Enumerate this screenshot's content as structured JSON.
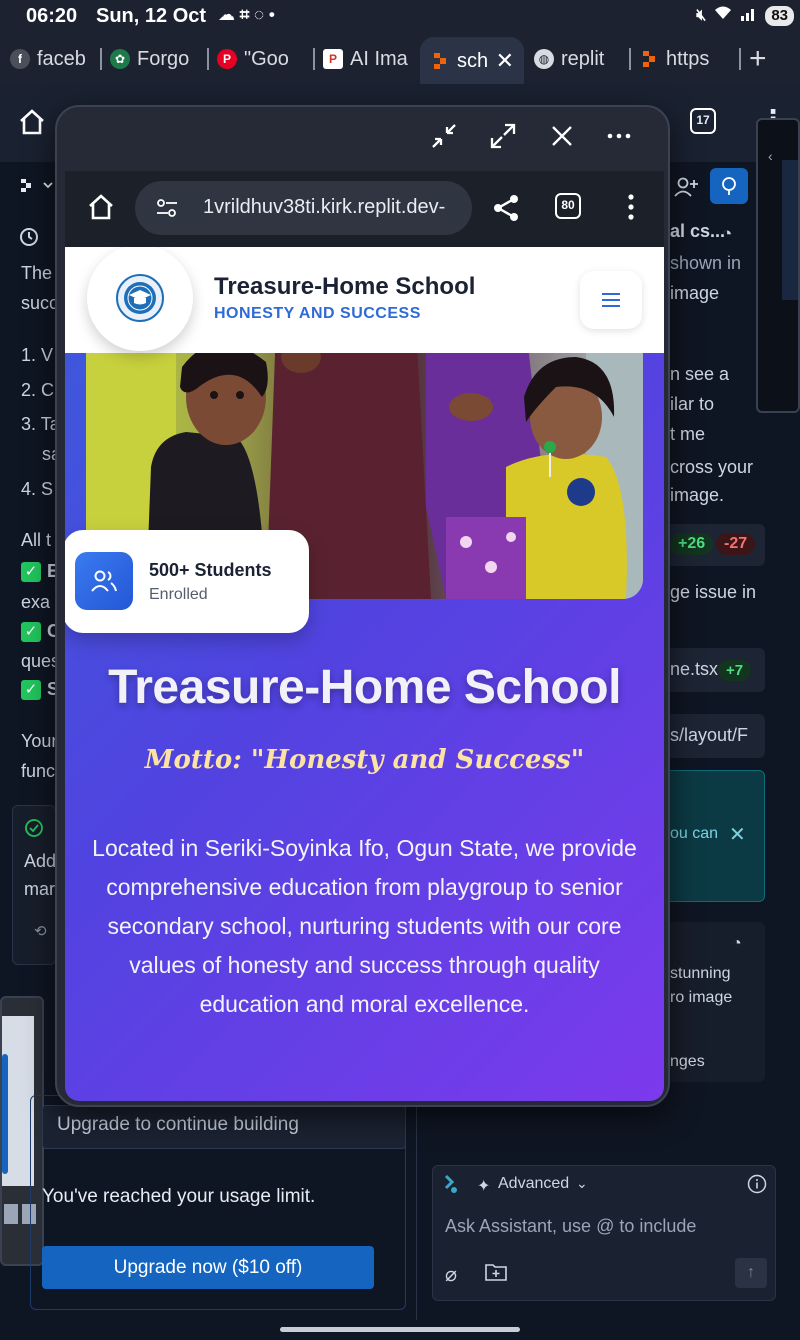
{
  "status_bar": {
    "time": "06:20",
    "date": "Sun, 12 Oct",
    "battery": "83"
  },
  "browser_tabs": [
    {
      "label": "faceb",
      "icon": "facebook-icon"
    },
    {
      "label": "Forgo",
      "icon": "forgot-site-icon"
    },
    {
      "label": "\"Goo",
      "icon": "pinterest-icon"
    },
    {
      "label": "AI Ima",
      "icon": "ai-image-icon"
    },
    {
      "label": "sch",
      "icon": "replit-icon",
      "active": true
    },
    {
      "label": "replit",
      "icon": "globe-icon"
    },
    {
      "label": "https",
      "icon": "replit-icon"
    }
  ],
  "background_app": {
    "header_tab_count": "17",
    "left_lines": [
      "The",
      "succ",
      "1. V",
      "2. C",
      "3. Ta",
      "sa",
      "4. S",
      "All t",
      "E",
      "exa",
      "C",
      "ques",
      "S",
      "Your",
      "func",
      "Add",
      "mar"
    ],
    "right_lines": [
      "al cs...",
      "shown in",
      "image",
      "n see a",
      "ilar to",
      "t me",
      "cross your",
      "image.",
      "ge issue in",
      "ne.tsx",
      "s/layout/F",
      "ou can",
      "stunning",
      "ro image",
      "nges"
    ],
    "diff_added": "+26",
    "diff_removed": "-27",
    "file_badge": "+7",
    "upgrade_bar": "Upgrade to continue building",
    "usage_limit": "You've reached your usage limit.",
    "upgrade_button": "Upgrade now ($10 off)",
    "assistant": {
      "mode": "Advanced",
      "placeholder": "Ask Assistant, use @ to include"
    }
  },
  "popup": {
    "url": "-1vrildhuv38ti.kirk.replit.dev",
    "tab_count": "80"
  },
  "site": {
    "brand_name": "Treasure-Home School",
    "brand_tagline": "HONESTY AND SUCCESS",
    "stat_number": "500+ Students",
    "stat_label": "Enrolled",
    "hero_title": "Treasure-Home School",
    "motto": "Motto: \"Honesty and Success\"",
    "description": "Located in Seriki-Soyinka Ifo, Ogun State, we provide comprehensive education from playgroup to senior secondary school, nurturing students with our core values of honesty and success through quality education and moral excellence."
  },
  "colors": {
    "brand_blue": "#2f6bd8",
    "gradient_start": "#3b5bdb",
    "gradient_end": "#7c3aed",
    "upgrade_button": "#1565c0",
    "motto_gold": "#fbe3a1"
  }
}
